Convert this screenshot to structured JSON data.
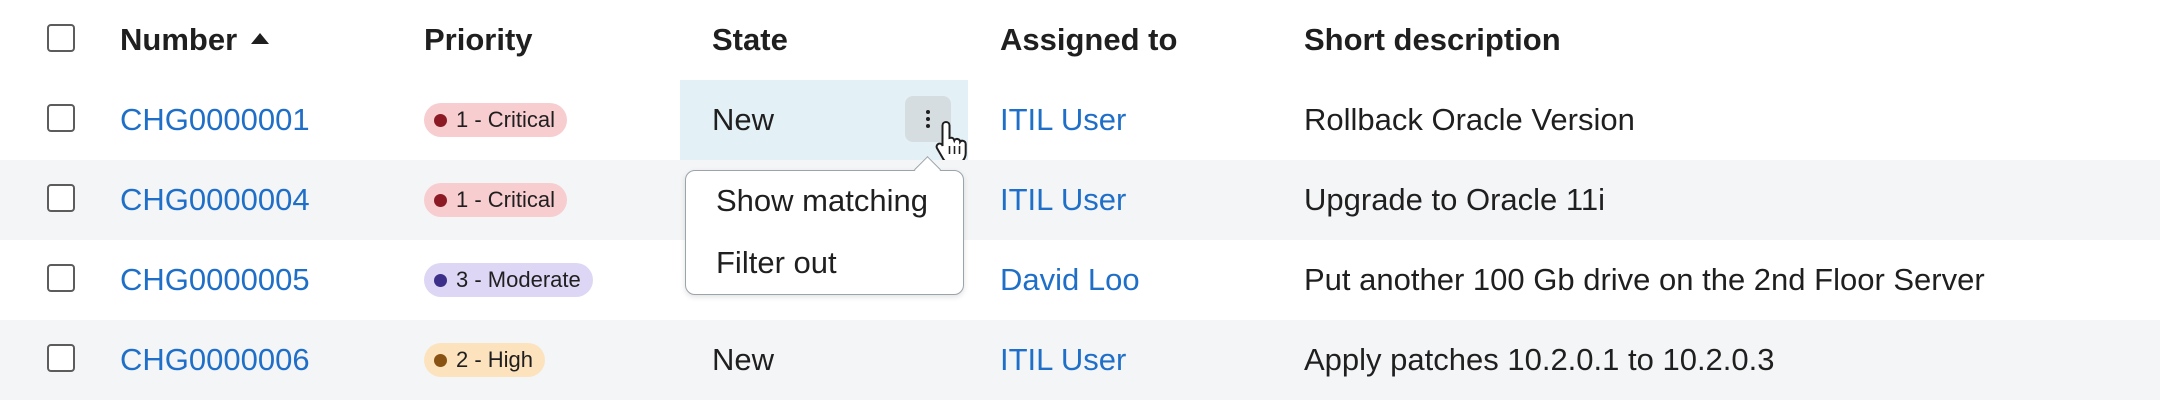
{
  "header": {
    "number": "Number",
    "priority": "Priority",
    "state": "State",
    "assigned_to": "Assigned to",
    "short_description": "Short description"
  },
  "rows": [
    {
      "number": "CHG0000001",
      "priority": {
        "label": "1 - Critical",
        "bg": "#f7cdd0",
        "dot": "#8c1a25"
      },
      "state": "New",
      "assigned_to": "ITIL User",
      "short_description": "Rollback Oracle Version"
    },
    {
      "number": "CHG0000004",
      "priority": {
        "label": "1 - Critical",
        "bg": "#f7cdd0",
        "dot": "#8c1a25"
      },
      "state": "",
      "assigned_to": "ITIL User",
      "short_description": "Upgrade to Oracle 11i"
    },
    {
      "number": "CHG0000005",
      "priority": {
        "label": "3 - Moderate",
        "bg": "#ddd6f5",
        "dot": "#3b2f8a"
      },
      "state": "",
      "assigned_to": "David Loo",
      "short_description": "Put another 100 Gb drive on the 2nd Floor Server"
    },
    {
      "number": "CHG0000006",
      "priority": {
        "label": "2 - High",
        "bg": "#fce3bd",
        "dot": "#8a5212"
      },
      "state": "New",
      "assigned_to": "ITIL User",
      "short_description": "Apply patches 10.2.0.1 to 10.2.0.3"
    }
  ],
  "context_menu": {
    "items": [
      "Show matching",
      "Filter out"
    ]
  },
  "colors": {
    "link": "#1f6fc8",
    "active_cell": "#e3f0f5",
    "stripe": "#f4f5f7"
  }
}
